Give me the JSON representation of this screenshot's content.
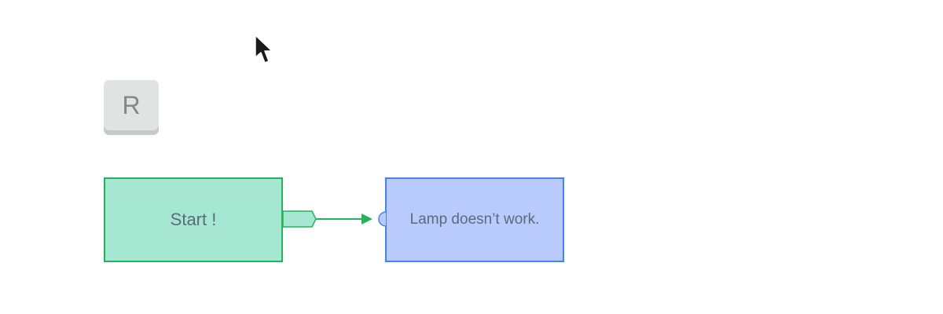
{
  "shortcut_key": {
    "label": "R"
  },
  "nodes": {
    "start": {
      "label": "Start !",
      "fill": "#a6e7d1",
      "border": "#22b45a"
    },
    "lamp": {
      "label": "Lamp doesn’t work.",
      "fill": "#b9cbfc",
      "border": "#4283ec"
    }
  },
  "edge": {
    "color": "#22b45a"
  },
  "icons": {
    "cursor": "mouse-pointer-icon"
  }
}
